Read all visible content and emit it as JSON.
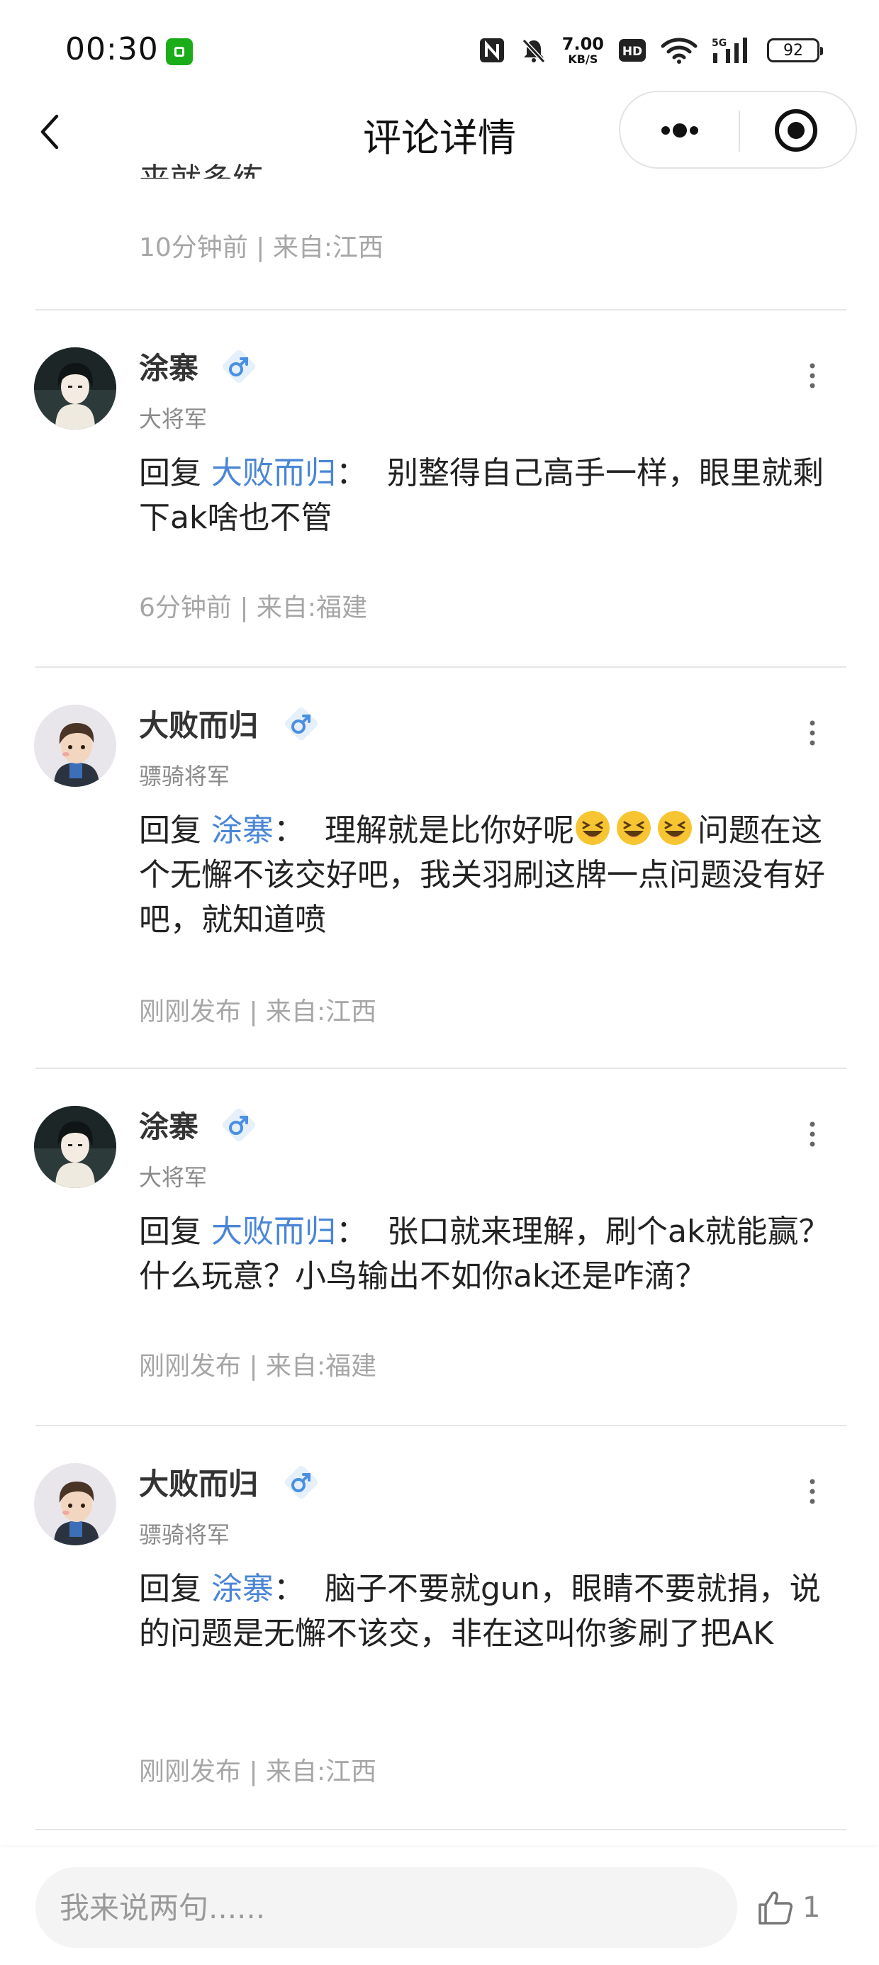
{
  "status_bar": {
    "time": "00:30",
    "net_speed_value": "7.00",
    "net_speed_unit": "KB/S",
    "battery": "92"
  },
  "nav": {
    "title": "评论详情"
  },
  "partial_comment": {
    "text_fragment": "来就多练",
    "meta": "10分钟前 | 来自:江西"
  },
  "comments": [
    {
      "username": "涂寨",
      "title": "大将军",
      "gender": "♂",
      "reply_prefix": "回复",
      "reply_to": "大败而归",
      "separator": "：",
      "text": "别整得自己高手一样，眼里就剩下ak啥也不管",
      "meta": "6分钟前 | 来自:福建"
    },
    {
      "username": "大败而归",
      "title": "骠骑将军",
      "gender": "♂",
      "reply_prefix": "回复",
      "reply_to": "涂寨",
      "separator": "：",
      "text_before_emoji": "理解就是比你好呢",
      "emoji": "laughing-emoji",
      "emoji_count": 3,
      "text_after_emoji": "问题在这个无懈不该交好吧，我关羽刷这牌一点问题没有好吧，就知道喷",
      "meta": "刚刚发布 | 来自:江西"
    },
    {
      "username": "涂寨",
      "title": "大将军",
      "gender": "♂",
      "reply_prefix": "回复",
      "reply_to": "大败而归",
      "separator": "：",
      "text": "张口就来理解，刷个ak就能赢？什么玩意？小鸟输出不如你ak还是咋滴？",
      "meta": "刚刚发布 | 来自:福建"
    },
    {
      "username": "大败而归",
      "title": "骠骑将军",
      "gender": "♂",
      "reply_prefix": "回复",
      "reply_to": "涂寨",
      "separator": "：",
      "text": "脑子不要就gun，眼睛不要就捐，说的问题是无懈不该交，非在这叫你爹刷了把AK",
      "meta": "刚刚发布 | 来自:江西"
    }
  ],
  "bottom_bar": {
    "input_placeholder": "我来说两句......",
    "like_count": "1"
  },
  "colors": {
    "mention": "#4a86d6",
    "meta": "#a6a6a6",
    "gender_badge": "#4a90e2"
  }
}
